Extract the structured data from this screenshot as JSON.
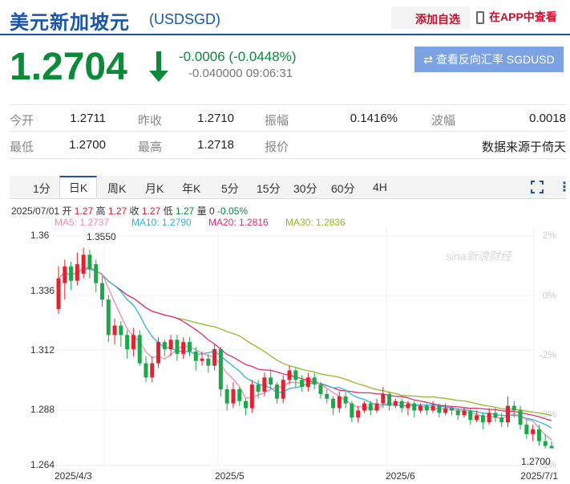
{
  "header": {
    "title": "美元新加坡元",
    "code": "(USDSGD)",
    "add_watch": "添加自选",
    "open_app": "在APP中查看"
  },
  "quote": {
    "price": "1.2704",
    "change": "-0.0006 (-0.0448%)",
    "sub": "-0.040000 09:06:31",
    "reverse_button": "查看反向汇率 SGDUSD"
  },
  "stats": {
    "row1": [
      {
        "label": "今开",
        "value": "1.2711"
      },
      {
        "label": "昨收",
        "value": "1.2710"
      },
      {
        "label": "振幅",
        "value": "0.1416%"
      },
      {
        "label": "波幅",
        "value": "0.0018"
      }
    ],
    "row2": [
      {
        "label": "最低",
        "value": "1.2700"
      },
      {
        "label": "最高",
        "value": "1.2718"
      },
      {
        "label": "报价",
        "value": "数据来源于倚天"
      }
    ]
  },
  "tabs": [
    "1分",
    "日K",
    "周K",
    "月K",
    "年K",
    "5分",
    "15分",
    "30分",
    "60分",
    "4H"
  ],
  "active_tab": "日K",
  "candle_info": {
    "date": "2025/07/01",
    "open_label": "开",
    "open": "1.27",
    "high_label": "高",
    "high": "1.27",
    "close_label": "收",
    "close": "1.27",
    "low_label": "低",
    "low": "1.27",
    "vol_label": "量",
    "vol": "0",
    "pct": "-0.05%"
  },
  "ma_legend": [
    {
      "text": "MA5: 1.2737",
      "color": "#f08cb0"
    },
    {
      "text": "MA10: 1.2790",
      "color": "#33b3d9"
    },
    {
      "text": "MA20: 1.2816",
      "color": "#e0306a"
    },
    {
      "text": "MA30: 1.2836",
      "color": "#94b82a"
    }
  ],
  "watermark": "sina新浪财经",
  "chart_data": {
    "type": "candlestick",
    "y_left_ticks": [
      "1.36",
      "1.336",
      "1.312",
      "1.288",
      "1.264"
    ],
    "y_right_ticks": [
      "2%",
      "0%",
      "-2%",
      "-3%",
      "-3%"
    ],
    "x_ticks": [
      "2025/4/3",
      "2025/5",
      "2025/6",
      "2025/7/1"
    ],
    "annotation_high": "1.3550",
    "annotation_low": "1.2700",
    "ylim": [
      1.262,
      1.362
    ],
    "up_color": "#e8202d",
    "down_color": "#1aa84a",
    "candles": [
      [
        1.329,
        1.342,
        1.327,
        1.347
      ],
      [
        1.34,
        1.347,
        1.333,
        1.35
      ],
      [
        1.347,
        1.341,
        1.337,
        1.349
      ],
      [
        1.341,
        1.348,
        1.339,
        1.353
      ],
      [
        1.344,
        1.352,
        1.342,
        1.355
      ],
      [
        1.352,
        1.346,
        1.342,
        1.354
      ],
      [
        1.348,
        1.34,
        1.336,
        1.35
      ],
      [
        1.34,
        1.333,
        1.33,
        1.343
      ],
      [
        1.333,
        1.318,
        1.315,
        1.335
      ],
      [
        1.318,
        1.322,
        1.314,
        1.325
      ],
      [
        1.322,
        1.318,
        1.313,
        1.324
      ],
      [
        1.318,
        1.312,
        1.308,
        1.32
      ],
      [
        1.312,
        1.318,
        1.309,
        1.321
      ],
      [
        1.318,
        1.306,
        1.305,
        1.32
      ],
      [
        1.306,
        1.3,
        1.298,
        1.309
      ],
      [
        1.3,
        1.306,
        1.298,
        1.309
      ],
      [
        1.306,
        1.315,
        1.304,
        1.317
      ],
      [
        1.315,
        1.312,
        1.309,
        1.316
      ],
      [
        1.312,
        1.316,
        1.309,
        1.318
      ],
      [
        1.316,
        1.31,
        1.307,
        1.318
      ],
      [
        1.31,
        1.315,
        1.308,
        1.317
      ],
      [
        1.315,
        1.311,
        1.309,
        1.317
      ],
      [
        1.311,
        1.307,
        1.303,
        1.313
      ],
      [
        1.307,
        1.308,
        1.305,
        1.311
      ],
      [
        1.308,
        1.305,
        1.302,
        1.31
      ],
      [
        1.305,
        1.312,
        1.303,
        1.314
      ],
      [
        1.312,
        1.295,
        1.292,
        1.313
      ],
      [
        1.295,
        1.289,
        1.286,
        1.297
      ],
      [
        1.289,
        1.295,
        1.287,
        1.298
      ],
      [
        1.295,
        1.29,
        1.288,
        1.296
      ],
      [
        1.29,
        1.287,
        1.284,
        1.291
      ],
      [
        1.287,
        1.297,
        1.285,
        1.299
      ],
      [
        1.297,
        1.294,
        1.291,
        1.299
      ],
      [
        1.294,
        1.3,
        1.292,
        1.302
      ],
      [
        1.3,
        1.297,
        1.295,
        1.303
      ],
      [
        1.297,
        1.291,
        1.289,
        1.298
      ],
      [
        1.291,
        1.299,
        1.289,
        1.301
      ],
      [
        1.299,
        1.303,
        1.297,
        1.305
      ],
      [
        1.303,
        1.299,
        1.296,
        1.304
      ],
      [
        1.299,
        1.296,
        1.294,
        1.301
      ],
      [
        1.296,
        1.3,
        1.294,
        1.302
      ],
      [
        1.3,
        1.297,
        1.295,
        1.302
      ],
      [
        1.297,
        1.293,
        1.291,
        1.298
      ],
      [
        1.293,
        1.291,
        1.289,
        1.295
      ],
      [
        1.291,
        1.287,
        1.284,
        1.292
      ],
      [
        1.287,
        1.292,
        1.285,
        1.294
      ],
      [
        1.292,
        1.289,
        1.287,
        1.294
      ],
      [
        1.289,
        1.283,
        1.281,
        1.29
      ],
      [
        1.283,
        1.286,
        1.281,
        1.288
      ],
      [
        1.286,
        1.289,
        1.285,
        1.29
      ],
      [
        1.289,
        1.286,
        1.284,
        1.29
      ],
      [
        1.286,
        1.289,
        1.285,
        1.291
      ],
      [
        1.289,
        1.293,
        1.287,
        1.296
      ],
      [
        1.293,
        1.288,
        1.286,
        1.294
      ],
      [
        1.288,
        1.29,
        1.287,
        1.291
      ],
      [
        1.29,
        1.287,
        1.285,
        1.291
      ],
      [
        1.287,
        1.289,
        1.284,
        1.29
      ],
      [
        1.289,
        1.286,
        1.283,
        1.29
      ],
      [
        1.286,
        1.288,
        1.285,
        1.289
      ],
      [
        1.288,
        1.286,
        1.284,
        1.289
      ],
      [
        1.286,
        1.288,
        1.285,
        1.29
      ],
      [
        1.288,
        1.285,
        1.283,
        1.289
      ],
      [
        1.285,
        1.287,
        1.284,
        1.289
      ],
      [
        1.287,
        1.286,
        1.284,
        1.288
      ],
      [
        1.286,
        1.284,
        1.282,
        1.287
      ],
      [
        1.284,
        1.286,
        1.283,
        1.287
      ],
      [
        1.286,
        1.282,
        1.28,
        1.287
      ],
      [
        1.282,
        1.284,
        1.281,
        1.286
      ],
      [
        1.284,
        1.281,
        1.278,
        1.285
      ],
      [
        1.281,
        1.285,
        1.28,
        1.287
      ],
      [
        1.285,
        1.283,
        1.281,
        1.287
      ],
      [
        1.283,
        1.281,
        1.279,
        1.285
      ],
      [
        1.281,
        1.288,
        1.279,
        1.292
      ],
      [
        1.288,
        1.286,
        1.283,
        1.29
      ],
      [
        1.286,
        1.28,
        1.278,
        1.288
      ],
      [
        1.28,
        1.276,
        1.274,
        1.282
      ],
      [
        1.276,
        1.278,
        1.273,
        1.28
      ],
      [
        1.278,
        1.273,
        1.271,
        1.28
      ],
      [
        1.273,
        1.271,
        1.27,
        1.276
      ],
      [
        1.271,
        1.27,
        1.27,
        1.273
      ]
    ]
  }
}
